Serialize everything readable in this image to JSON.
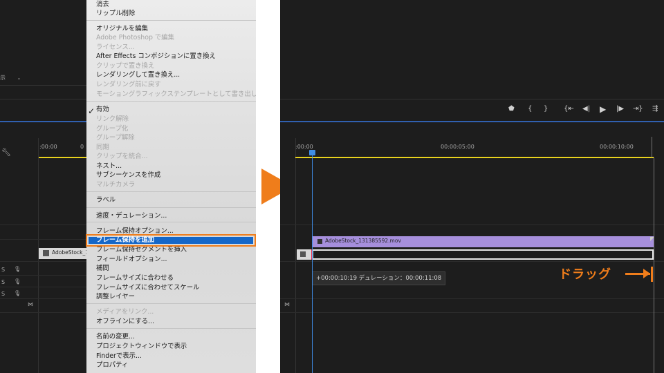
{
  "left": {
    "display_dropdown": "示",
    "timecode": ":00:00",
    "timecode2": "0",
    "clip_label": "AdobeStock_131",
    "track_s1": "S",
    "track_s2": "S",
    "track_s3": "S",
    "tool_icon": "wrench-icon"
  },
  "menu": {
    "items": [
      {
        "label": "消去",
        "enabled": true
      },
      {
        "label": "リップル削除",
        "enabled": true
      },
      {
        "label": "オリジナルを編集",
        "enabled": true
      },
      {
        "label": "Adobe Photoshop で編集",
        "enabled": false
      },
      {
        "label": "ライセンス...",
        "enabled": false
      },
      {
        "label": "After Effects コンポジションに置き換え",
        "enabled": true
      },
      {
        "label": "クリップで置き換え",
        "enabled": false
      },
      {
        "label": "レンダリングして置き換え...",
        "enabled": true
      },
      {
        "label": "レンダリング前に戻す",
        "enabled": false
      },
      {
        "label": "モーショングラフィックステンプレートとして書き出し",
        "enabled": false
      },
      {
        "label": "有効",
        "enabled": true,
        "checked": true
      },
      {
        "label": "リンク解除",
        "enabled": false
      },
      {
        "label": "グループ化",
        "enabled": false
      },
      {
        "label": "グループ解除",
        "enabled": false
      },
      {
        "label": "同期",
        "enabled": false
      },
      {
        "label": "クリップを統合...",
        "enabled": false
      },
      {
        "label": "ネスト...",
        "enabled": true
      },
      {
        "label": "サブシーケンスを作成",
        "enabled": true
      },
      {
        "label": "マルチカメラ",
        "enabled": false
      },
      {
        "label": "ラベル",
        "enabled": true
      },
      {
        "label": "速度・デュレーション...",
        "enabled": true
      },
      {
        "label": "フレーム保持オプション...",
        "enabled": true
      },
      {
        "label": "フレーム保持を追加",
        "enabled": true,
        "highlighted": true
      },
      {
        "label": "フレーム保持セグメントを挿入",
        "enabled": true
      },
      {
        "label": "フィールドオプション...",
        "enabled": true
      },
      {
        "label": "補間",
        "enabled": true
      },
      {
        "label": "フレームサイズに合わせる",
        "enabled": true
      },
      {
        "label": "フレームサイズに合わせてスケール",
        "enabled": true
      },
      {
        "label": "調整レイヤー",
        "enabled": true
      },
      {
        "label": "メディアをリンク...",
        "enabled": false
      },
      {
        "label": "オフラインにする...",
        "enabled": true
      },
      {
        "label": "名前の変更...",
        "enabled": true
      },
      {
        "label": "プロジェクトウィンドウで表示",
        "enabled": true
      },
      {
        "label": "Finderで表示...",
        "enabled": true
      },
      {
        "label": "プロパティ",
        "enabled": true
      }
    ]
  },
  "right": {
    "ruler": [
      ":00:00",
      "00:00:05:00",
      "00:00:10:00"
    ],
    "clip_name": "AdobeStock_131385592.mov",
    "tooltip": "+00:00:10:19 デュレーション：00:00:11:08",
    "drag_label": "ドラッグ"
  },
  "colors": {
    "accent": "#ef7d1b",
    "clip_purple": "#a68fdc",
    "selection_blue": "#1567c8",
    "playhead_blue": "#3f8ee8",
    "in_out_yellow": "#e8d21d"
  }
}
